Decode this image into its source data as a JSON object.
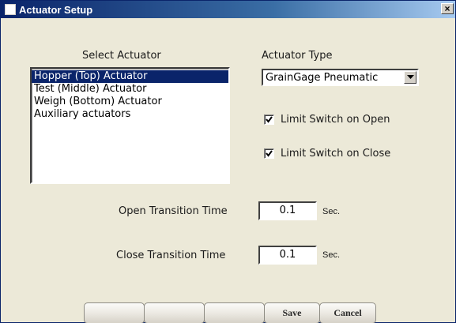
{
  "window": {
    "title": "Actuator Setup",
    "close_glyph": "×"
  },
  "select_actuator": {
    "label": "Select Actuator",
    "items": [
      {
        "label": "Hopper (Top) Actuator",
        "selected": true
      },
      {
        "label": "Test (Middle) Actuator",
        "selected": false
      },
      {
        "label": "Weigh (Bottom) Actuator",
        "selected": false
      },
      {
        "label": "Auxiliary actuators",
        "selected": false
      }
    ]
  },
  "actuator_type": {
    "label": "Actuator Type",
    "value": "GrainGage Pneumatic"
  },
  "options": {
    "limit_open": {
      "label": "Limit Switch on Open",
      "checked": true
    },
    "limit_close": {
      "label": "Limit Switch on Close",
      "checked": true
    }
  },
  "open_transition": {
    "label": "Open Transition Time",
    "value": "0.1",
    "unit": "Sec."
  },
  "close_transition": {
    "label": "Close Transition Time",
    "value": "0.1",
    "unit": "Sec."
  },
  "buttons": {
    "blank_1": "",
    "blank_2": "",
    "blank_3": "",
    "save": "Save",
    "cancel": "Cancel"
  },
  "colors": {
    "title_bar": "#0a246a",
    "selection": "#0a246a",
    "dialog_bg": "#ece9d8"
  }
}
